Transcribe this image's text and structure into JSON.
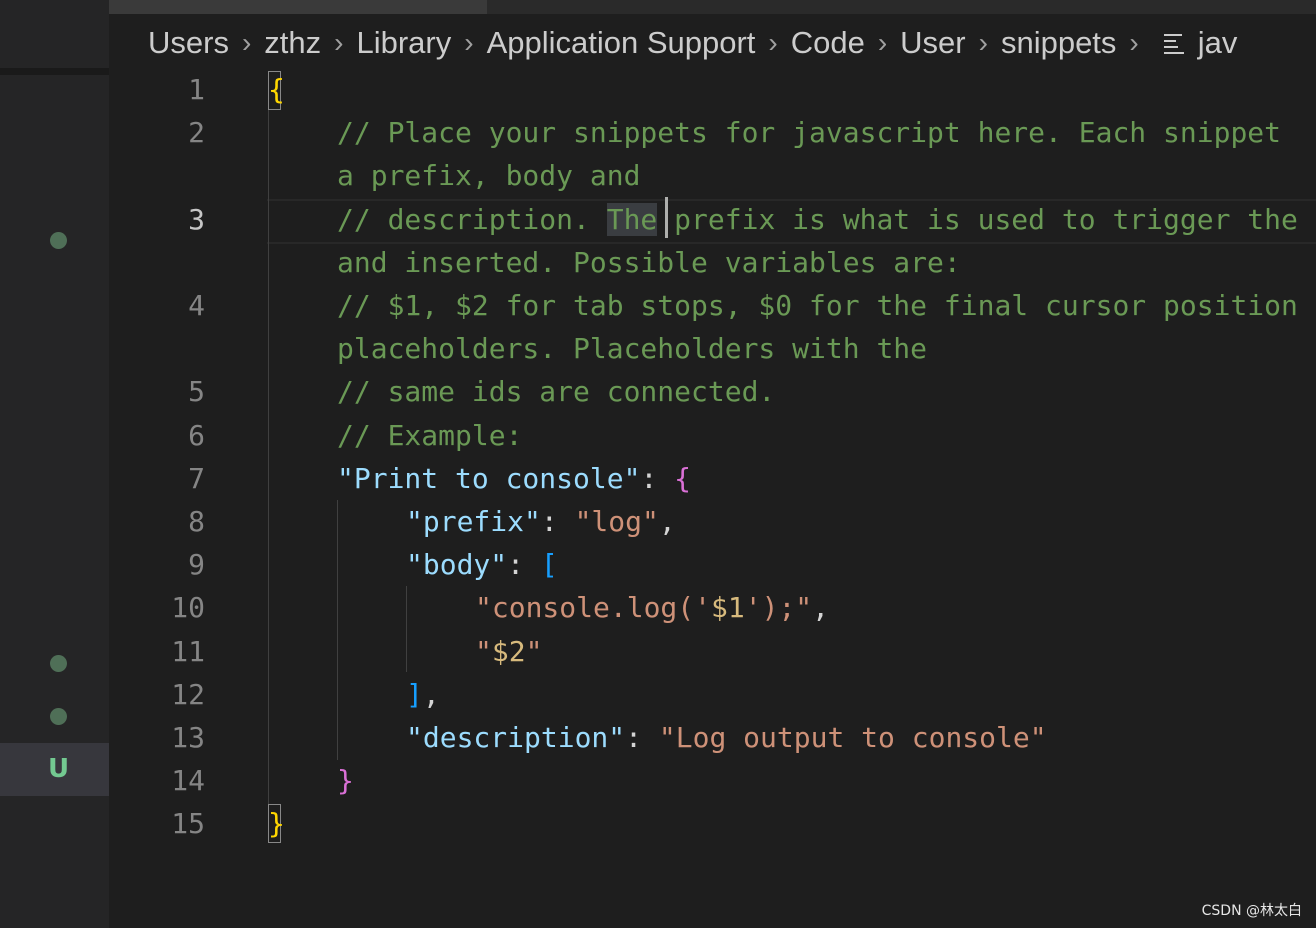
{
  "breadcrumb": {
    "items": [
      "Users",
      "zthz",
      "Library",
      "Application Support",
      "Code",
      "User",
      "snippets"
    ],
    "file_icon": "symbol-file-lines-icon",
    "file_label": "jav"
  },
  "scm": {
    "untracked_badge": "U",
    "modified_marker": "dot-icon"
  },
  "editor": {
    "active_line": "3",
    "line_numbers": [
      "1",
      "2",
      "3",
      "4",
      "5",
      "6",
      "7",
      "8",
      "9",
      "10",
      "11",
      "12",
      "13",
      "14",
      "15"
    ],
    "lines": {
      "l1": "{",
      "l2a": "// Place your snippets for javascript here. Each snippet",
      "l2b": "a prefix, body and",
      "l3a_pre": "// description. ",
      "l3a_sel": "The",
      "l3a_post": " prefix is what is used to trigger the",
      "l3b": "and inserted. Possible variables are:",
      "l4a": "// $1, $2 for tab stops, $0 for the final cursor position",
      "l4b": "placeholders. Placeholders with the",
      "l5": "// same ids are connected.",
      "l6": "// Example:",
      "l7_key": "\"Print to console\"",
      "l7_colon": ": ",
      "l7_brace": "{",
      "l8_key": "\"prefix\"",
      "l8_colon": ": ",
      "l8_val": "\"log\"",
      "l8_comma": ",",
      "l9_key": "\"body\"",
      "l9_colon": ": ",
      "l9_bracket": "[",
      "l10_q1": "\"console.log('",
      "l10_esc": "$1",
      "l10_q2": "');\"",
      "l10_comma": ",",
      "l11_q1": "\"",
      "l11_esc": "$2",
      "l11_q2": "\"",
      "l12_bracket": "]",
      "l12_comma": ",",
      "l13_key": "\"description\"",
      "l13_colon": ": ",
      "l13_val": "\"Log output to console\"",
      "l14": "}",
      "l15": "}"
    }
  },
  "watermark": "CSDN @林太白",
  "colors": {
    "background": "#1e1e1e",
    "comment": "#6a9955",
    "key": "#9cdcfe",
    "string": "#ce9178",
    "bracket_level1": "#ffd700",
    "bracket_level2": "#da70d6",
    "bracket_level3": "#179fff",
    "untracked": "#73c991"
  }
}
